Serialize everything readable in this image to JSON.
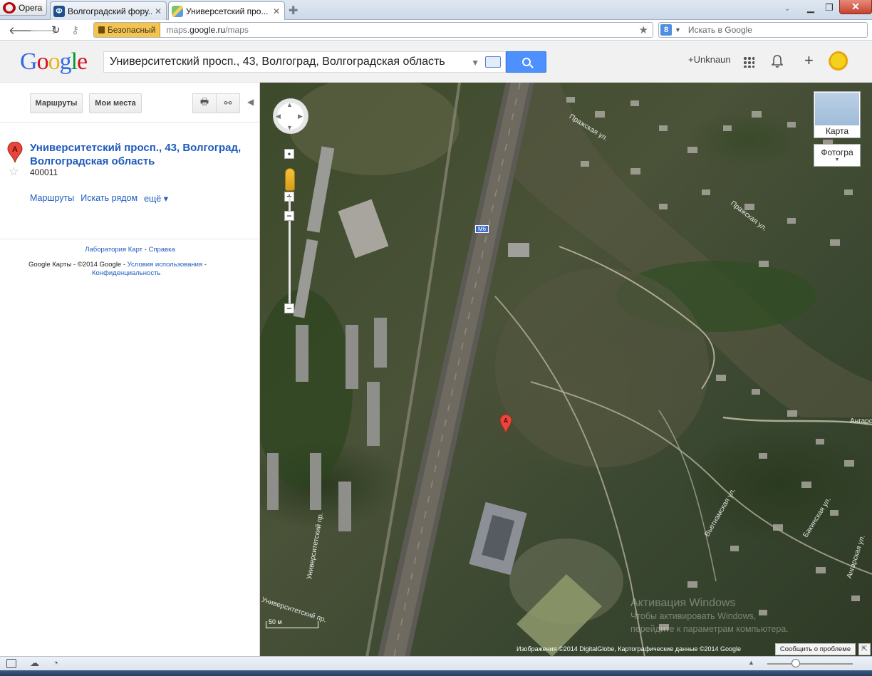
{
  "browser": {
    "opera_label": "Opera",
    "tabs": [
      {
        "label": "Волгоградский фору...",
        "favicon": "Ф"
      },
      {
        "label": "Универсетский про..."
      }
    ],
    "security_label": "Безопасный",
    "url_prefix": "maps.",
    "url_domain": "google.ru",
    "url_path": "/maps",
    "search_engine_letter": "8",
    "search_placeholder": "Искать в Google"
  },
  "google": {
    "search_value": "Университетский просп., 43, Волгоград, Волгоградская область",
    "user_label": "+Unknaun"
  },
  "panel": {
    "directions_button": "Маршруты",
    "my_places_button": "Мои места",
    "place_title": "Университетский просп., 43, Волгоград, Волгоградская область",
    "postal_code": "400011",
    "links": [
      "Маршруты",
      "Искать рядом",
      "ещё ▾"
    ],
    "footer_lab": "Лаборатория Карт",
    "footer_dash": " - ",
    "footer_help": "Справка",
    "footer_maps": "Google Карты",
    "footer_copyright": " - ©2014 Google - ",
    "footer_terms": "Условия использования",
    "footer_privacy": "Конфиденциальность"
  },
  "map": {
    "type_map": "Карта",
    "type_photo": "Фотогра",
    "marker_label": "A",
    "scale_label": "50 м",
    "road_shield": "M6",
    "street_labels": [
      "Университетский пр.",
      "Пражская ул.",
      "Пражская ул.",
      "Вьетнамская ул.",
      "Бакинская ул.",
      "Ангарская ул.",
      "Ангарская ул.",
      "Университетский пр."
    ],
    "report_button": "Сообщить о проблеме",
    "copyright": "Изображения ©2014 DigitalGlobe, Картографические данные ©2014 Google",
    "watermark_line1": "Активация Windows",
    "watermark_line2": "Чтобы активировать Windows,",
    "watermark_line3": "перейдите к параметрам компьютера."
  }
}
